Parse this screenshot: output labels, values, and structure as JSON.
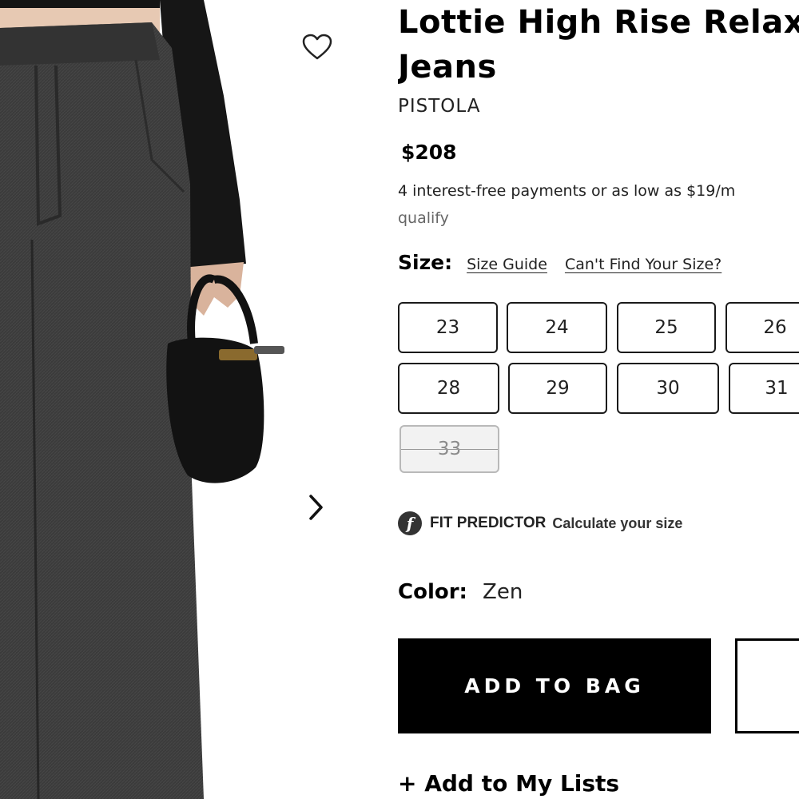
{
  "product": {
    "title_line1": "Lottie High Rise Relax",
    "title_line2": "Jeans",
    "brand": "PISTOLA",
    "price": "$208",
    "payments_text": "4 interest-free payments or as low as $19/m",
    "payments_qualify": "qualify"
  },
  "gallery": {
    "wishlist_icon": "heart-outline-icon",
    "next_icon": "chevron-right-icon"
  },
  "size": {
    "label": "Size:",
    "guide_link": "Size Guide",
    "find_link": "Can't Find Your Size?",
    "options": [
      {
        "value": "23",
        "available": true
      },
      {
        "value": "24",
        "available": true
      },
      {
        "value": "25",
        "available": true
      },
      {
        "value": "26",
        "available": true
      },
      {
        "value": "28",
        "available": true
      },
      {
        "value": "29",
        "available": true
      },
      {
        "value": "30",
        "available": true
      },
      {
        "value": "31",
        "available": true
      },
      {
        "value": "33",
        "available": false
      }
    ]
  },
  "fit_predictor": {
    "logo_glyph": "f",
    "title": "FIT PREDICTOR",
    "subtitle": "Calculate your size"
  },
  "color": {
    "label": "Color:",
    "value": "Zen"
  },
  "actions": {
    "add_to_bag": "ADD TO BAG",
    "add_to_lists": "+ Add to My Lists"
  },
  "colors": {
    "primary": "#000000",
    "denim": "#3a3a3a",
    "disabled_bg": "#f2f2f2"
  }
}
